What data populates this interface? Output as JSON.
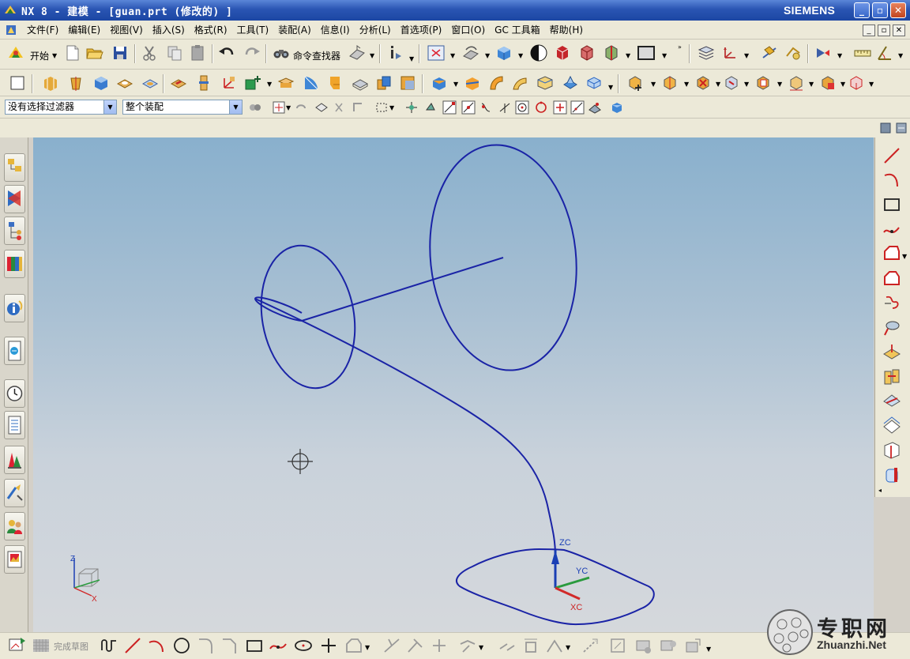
{
  "window": {
    "title": "NX 8 - 建模 - [guan.prt  (修改的) ]",
    "brand": "SIEMENS",
    "controls": [
      "_",
      "▫",
      "✕"
    ]
  },
  "menubar": {
    "items": [
      "文件(F)",
      "编辑(E)",
      "视图(V)",
      "插入(S)",
      "格式(R)",
      "工具(T)",
      "装配(A)",
      "信息(I)",
      "分析(L)",
      "首选项(P)",
      "窗口(O)",
      "GC 工具箱",
      "帮助(H)"
    ]
  },
  "toolbar_standard": {
    "start_label": "开始",
    "command_finder_label": "命令查找器"
  },
  "selection_bar": {
    "filter_value": "没有选择过滤器",
    "scope_value": "整个装配"
  },
  "viewport": {
    "csys_labels": {
      "zc": "ZC",
      "yc": "YC",
      "xc": "XC"
    },
    "triad_labels": {
      "z": "Z",
      "x": "X"
    },
    "colors": {
      "curve": "#1a23a6",
      "bg_top": "#89b0cd",
      "bg_bottom": "#d5d8dc"
    }
  },
  "sketch_toolbar": {
    "finish_label": "完成草图"
  },
  "watermark": {
    "text": "专职网",
    "url": "Zhuanzhi.Net"
  }
}
